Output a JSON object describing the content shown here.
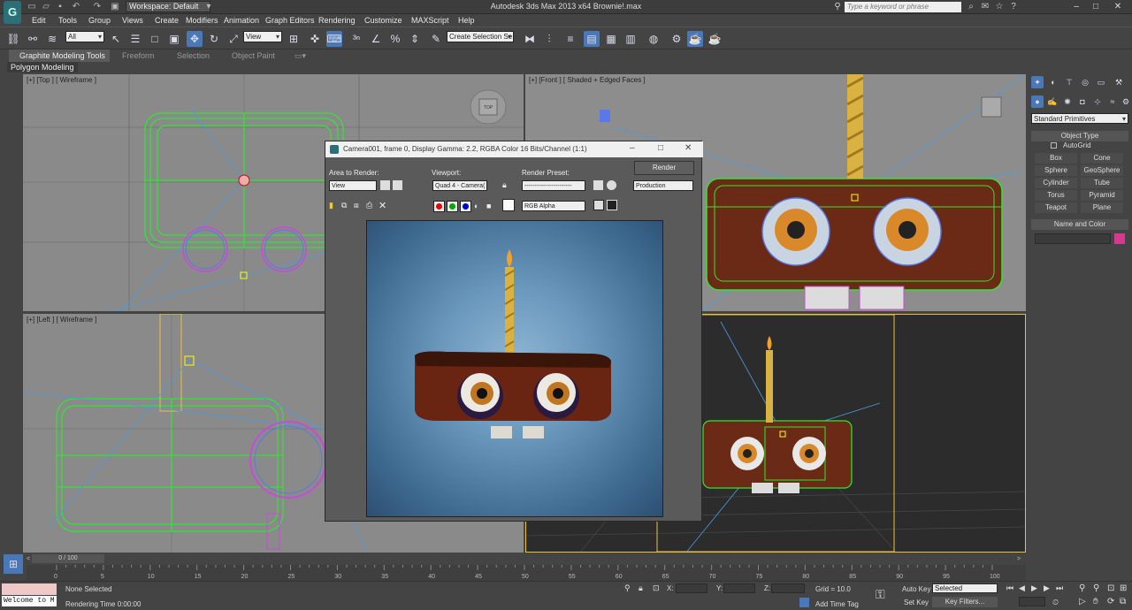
{
  "app": {
    "title": "Autodesk 3ds Max  2013 x64     Brownie!.max",
    "workspace": "Workspace: Default",
    "search_placeholder": "Type a keyword or phrase",
    "logo": "G"
  },
  "menu": [
    "Edit",
    "Tools",
    "Group",
    "Views",
    "Create",
    "Modifiers",
    "Animation",
    "Graph Editors",
    "Rendering",
    "Customize",
    "MAXScript",
    "Help"
  ],
  "toolbar": {
    "selection_filter": "All",
    "ref_coord": "View",
    "named_selection": "Create Selection Se"
  },
  "ribbon": {
    "tabs": [
      "Graphite Modeling Tools",
      "Freeform",
      "Selection",
      "Object Paint"
    ],
    "panel_label": "Polygon Modeling"
  },
  "viewports": {
    "top": "[+] [Top ] [ Wireframe ]",
    "front": "[+] [Front ] [ Shaded + Edged Faces ]",
    "left": "[+] [Left ] [ Wireframe ]",
    "viewcube_top": "TOP"
  },
  "render_window": {
    "title": "Camera001, frame 0, Display Gamma: 2.2, RGBA Color 16 Bits/Channel (1:1)",
    "area_label": "Area to Render:",
    "area_value": "View",
    "viewport_label": "Viewport:",
    "viewport_value": "Quad 4 - Camera(",
    "preset_label": "Render Preset:",
    "preset_value": "-----------------------",
    "render_button": "Render",
    "production_value": "Production",
    "channel_value": "RGB Alpha"
  },
  "command_panel": {
    "category": "Standard Primitives",
    "object_type_title": "Object Type",
    "autogrid": "AutoGrid",
    "buttons": [
      "Box",
      "Cone",
      "Sphere",
      "GeoSphere",
      "Cylinder",
      "Tube",
      "Torus",
      "Pyramid",
      "Teapot",
      "Plane"
    ],
    "name_color_title": "Name and Color"
  },
  "timeline": {
    "frame_counter": "0 / 100",
    "ticks": [
      "0",
      "5",
      "10",
      "15",
      "20",
      "25",
      "30",
      "35",
      "40",
      "45",
      "50",
      "55",
      "60",
      "65",
      "70",
      "75",
      "80",
      "85",
      "90",
      "95",
      "100"
    ]
  },
  "status": {
    "listener": "Welcome to M",
    "selection": "None Selected",
    "render_time": "Rendering Time  0:00:00",
    "x_label": "X:",
    "y_label": "Y:",
    "z_label": "Z:",
    "grid": "Grid = 10.0",
    "auto_key": "Auto Key",
    "set_key": "Set Key",
    "key_mode": "Selected",
    "key_filters": "Key Filters...",
    "add_time_tag": "Add Time Tag"
  },
  "colors": {
    "accent": "#4a77b5",
    "wire_green": "#2ee82e",
    "brownie": "#6b2a16",
    "object_swatch": "#d2398f"
  }
}
